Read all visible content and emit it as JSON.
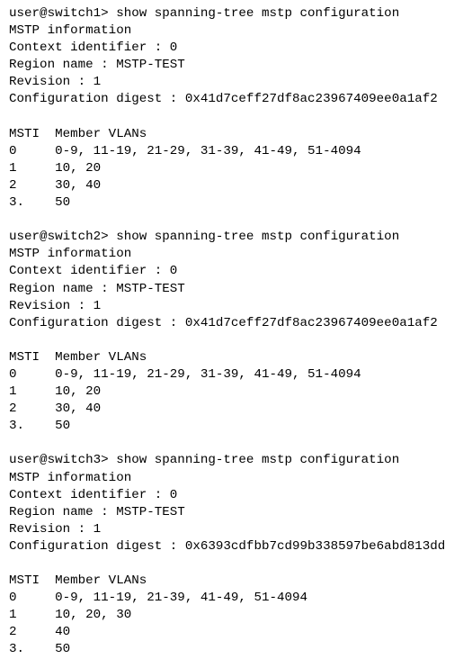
{
  "terminal": {
    "background_color": "#ffffff",
    "text_color": "#000000",
    "blocks": [
      {
        "prompt": "user@switch1> show spanning-tree mstp configuration",
        "heading": "MSTP information",
        "context_identifier": "Context identifier : 0",
        "region_name": "Region name : MSTP-TEST",
        "revision": "Revision : 1",
        "configuration_digest": "Configuration digest : 0x41d7ceff27df8ac23967409ee0a1af2",
        "table_header": "MSTI  Member VLANs",
        "rows": [
          "0     0-9, 11-19, 21-29, 31-39, 41-49, 51-4094",
          "1     10, 20",
          "2     30, 40",
          "3.    50"
        ]
      },
      {
        "prompt": "user@switch2> show spanning-tree mstp configuration",
        "heading": "MSTP information",
        "context_identifier": "Context identifier : 0",
        "region_name": "Region name : MSTP-TEST",
        "revision": "Revision : 1",
        "configuration_digest": "Configuration digest : 0x41d7ceff27df8ac23967409ee0a1af2",
        "table_header": "MSTI  Member VLANs",
        "rows": [
          "0     0-9, 11-19, 21-29, 31-39, 41-49, 51-4094",
          "1     10, 20",
          "2     30, 40",
          "3.    50"
        ]
      },
      {
        "prompt": "user@switch3> show spanning-tree mstp configuration",
        "heading": "MSTP information",
        "context_identifier": "Context identifier : 0",
        "region_name": "Region name : MSTP-TEST",
        "revision": "Revision : 1",
        "configuration_digest": "Configuration digest : 0x6393cdfbb7cd99b338597be6abd813dd",
        "table_header": "MSTI  Member VLANs",
        "rows": [
          "0     0-9, 11-19, 21-39, 41-49, 51-4094",
          "1     10, 20, 30",
          "2     40",
          "3.    50"
        ]
      }
    ]
  }
}
